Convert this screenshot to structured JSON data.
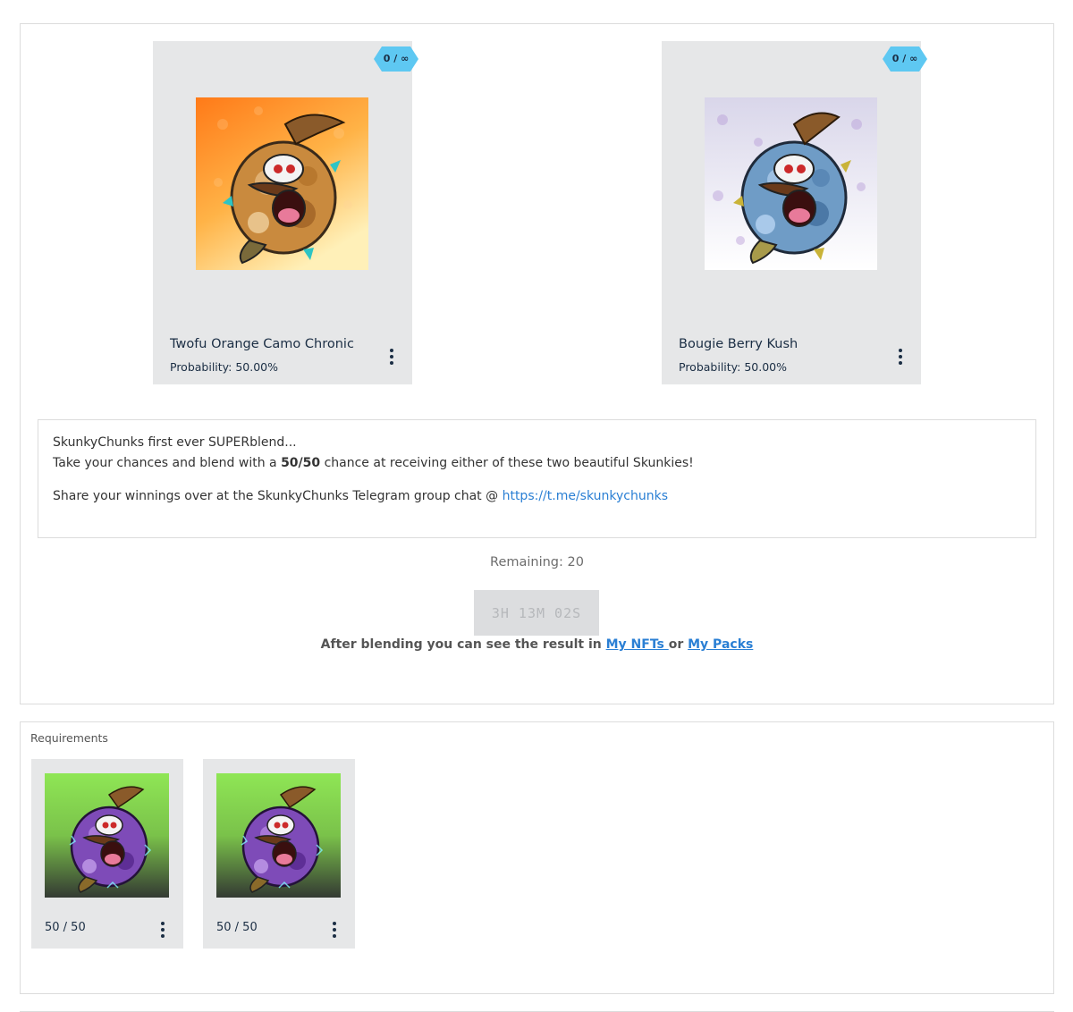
{
  "colors": {
    "card_bg": "#e6e7e8",
    "badge": "#5ec8f2",
    "link": "#2a7fd4",
    "text_dark": "#1b2e44",
    "disabled_button": "#dcdddf"
  },
  "results": [
    {
      "name": "Twofu Orange Camo Chronic",
      "probability": "Probability: 50.00%",
      "badge": "0 / ∞",
      "art": "orange camo skunk character"
    },
    {
      "name": "Bougie Berry Kush",
      "probability": "Probability: 50.00%",
      "badge": "0 / ∞",
      "art": "blue berry skunk character"
    }
  ],
  "description": {
    "line1": "SkunkyChunks first ever SUPERblend...",
    "line2_before": "Take your chances and blend with a ",
    "line2_bold": "50/50",
    "line2_after": " chance at receiving either of these two beautiful Skunkies!",
    "line3": "Share your winnings over at the SkunkyChunks Telegram group chat @ ",
    "link": "https://t.me/skunkychunks"
  },
  "remaining": "Remaining: 20",
  "timer": "3H 13M 02S",
  "after_blend": {
    "text": "After blending you can see the result in ",
    "link1": "My NFTs ",
    "or": "or ",
    "link2": "My Packs"
  },
  "requirements": {
    "title": "Requirements",
    "items": [
      {
        "count": "50 / 50",
        "art": "purple skunk character"
      },
      {
        "count": "50 / 50",
        "art": "purple skunk character"
      }
    ]
  }
}
